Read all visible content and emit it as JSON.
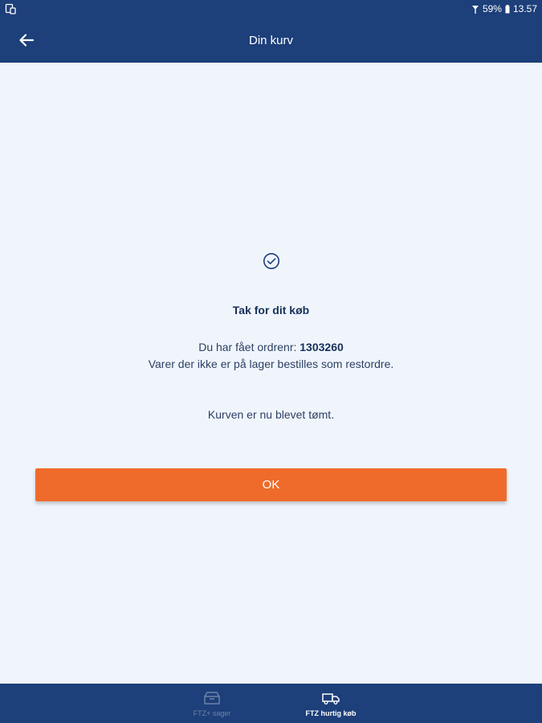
{
  "status_bar": {
    "battery": "59%",
    "time": "13.57"
  },
  "header": {
    "title": "Din kurv"
  },
  "confirmation": {
    "heading": "Tak for dit køb",
    "order_prefix": "Du har fået ordrenr:",
    "order_number": "1303260",
    "backorder_note": "Varer der ikke er på lager bestilles som restordre.",
    "cart_cleared": "Kurven er nu blevet tømt."
  },
  "ok_button": {
    "label": "OK",
    "color": "#ef6b2b"
  },
  "bottom_nav": {
    "items": [
      {
        "label": "FTZ+ sager",
        "icon": "box-icon",
        "active": false
      },
      {
        "label": "FTZ hurtig køb",
        "icon": "truck-icon",
        "active": true
      }
    ]
  },
  "colors": {
    "primary": "#1d3f7a",
    "background": "#f0f5fc",
    "accent": "#ef6b2b"
  }
}
